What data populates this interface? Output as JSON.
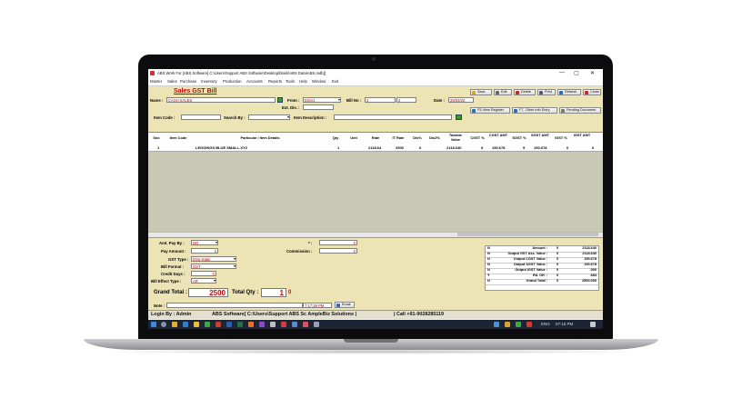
{
  "window": {
    "title": "ABS Work For [ABS Software] C:\\Users\\Support ABS Software\\Desktop\\blank\\ABS Data\\ABS.mdb]]",
    "min": "—",
    "max": "▢",
    "close": "✕"
  },
  "menu": [
    "Master",
    "Sales",
    "Purchase",
    "Inventory",
    "Production",
    "Accounts",
    "Reports",
    "Tools",
    "Help",
    "Window",
    "Exit"
  ],
  "form": {
    "heading": "Sales GST Bill",
    "name_label": "Name :",
    "name_value": "CASH SALES",
    "from_label": "From :",
    "from_value": "Direct",
    "billno_label": "Bill No :",
    "billno_value": "2",
    "billno_value2": "2",
    "date_label": "Date :",
    "date_value": "28/03/20",
    "extdis_label": "Ext. Dis. :",
    "itemcode_label": "Item Code :",
    "searchby_label": "Search By :",
    "itemdesc_label": "Item Description :"
  },
  "toolbar": {
    "save": "Save",
    "edit": "Edit",
    "delete": "Delete",
    "print": "Print",
    "refresh": "Refresh",
    "close": "Close",
    "view_register": "F5-View Register",
    "other_info": "F7- Other Info Entry",
    "pending": "Pending Document"
  },
  "grid": {
    "headers": [
      "Sno",
      "Item Code",
      "Particular / Item Details",
      "Qty",
      "Unit",
      "Rate",
      "IT Rate",
      "Dis%",
      "Dis2%",
      "Taxable Value",
      "CGST %",
      "CGST AMT",
      "SGST %",
      "SGST AMT",
      "IGST %",
      "IGST AMT"
    ],
    "rows": [
      [
        "1",
        "",
        "LEGGINGS BLUE SMALL-XYZ",
        "1",
        "",
        "2118.64",
        "2500",
        "0",
        "",
        "2118.640",
        "9",
        "190.678",
        "9",
        "190.678",
        "0",
        "0"
      ]
    ]
  },
  "payment": {
    "amt_pay_by_label": "Amt. Pay By :",
    "amt_pay_by": "NO",
    "pay_amount_label": "Pay Amount :",
    "pay_amount": "0",
    "gst_type_label": "GST Type :",
    "gst_type": "Intra-State",
    "bill_format_label": "Bill Format :",
    "bill_format": "GST",
    "credit_days_label": "Credit Days :",
    "credit_days": "0",
    "bill_effect_label": "Bill Effect Type :",
    "bill_effect": "AR",
    "star_label": "* :",
    "star_value": "0",
    "commission_label": "Commission :",
    "commission_value": "0"
  },
  "totals": {
    "grand_total_label": "Grand Total :",
    "grand_total": "2500",
    "total_qty_label": "Total Qty :",
    "total_qty": "1",
    "qty_extra": "0",
    "note_label": "Note :",
    "time": "7:17:28 PM",
    "email": "Email"
  },
  "summary": [
    {
      "flag": "N",
      "label": "Amount :",
      "pct": "0",
      "value": "2118.640"
    },
    {
      "flag": "N",
      "label": "Output GST Ass. Value :",
      "pct": "0",
      "value": "2118.640"
    },
    {
      "flag": "N",
      "label": "Output CGST Value :",
      "pct": "0",
      "value": "190.678"
    },
    {
      "flag": "N",
      "label": "Output SGST Value :",
      "pct": "0",
      "value": "190.678"
    },
    {
      "flag": "N",
      "label": "Output IGST Value :",
      "pct": "0",
      "value": ".000"
    },
    {
      "flag": "Y",
      "label": "Rd. Off. :",
      "pct": "0",
      "value": ".684"
    },
    {
      "flag": "N",
      "label": "Grand Total :",
      "pct": "0",
      "value": "2500.000"
    }
  ],
  "status": {
    "login": "Login By : Admin",
    "software": "ABS Software[ C:\\Users\\Support ABS Sc AmpleBiz Solutions |",
    "call": "| Call +91-9028285119"
  },
  "taskbar": {
    "lang": "ENG",
    "clock": "07:15 PM"
  },
  "colors": {
    "heading": "#d40000",
    "form_bg": "#ede4b6",
    "grid_bg": "#c8c8b4",
    "taskbar": "#1d2436"
  }
}
